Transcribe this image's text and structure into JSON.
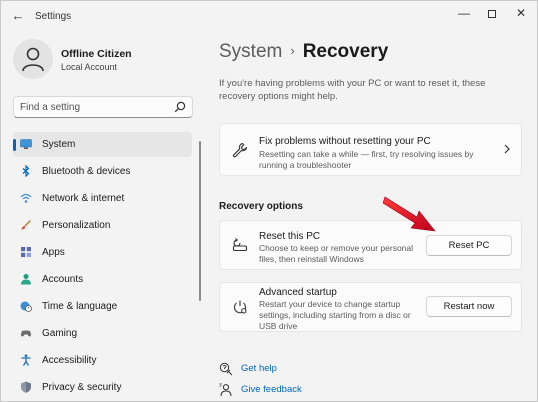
{
  "window": {
    "title": "Settings",
    "back": "←",
    "minimize": "—",
    "close": "✕"
  },
  "profile": {
    "name": "Offline Citizen",
    "account_type": "Local Account",
    "avatar_icon": "person-icon"
  },
  "search": {
    "placeholder": "Find a setting",
    "icon": "search-icon"
  },
  "nav": {
    "items": [
      {
        "label": "System",
        "icon": "monitor-icon",
        "active": true
      },
      {
        "label": "Bluetooth & devices",
        "icon": "bluetooth-icon"
      },
      {
        "label": "Network & internet",
        "icon": "wifi-icon"
      },
      {
        "label": "Personalization",
        "icon": "brush-icon"
      },
      {
        "label": "Apps",
        "icon": "apps-icon"
      },
      {
        "label": "Accounts",
        "icon": "person-icon"
      },
      {
        "label": "Time & language",
        "icon": "globe-clock-icon"
      },
      {
        "label": "Gaming",
        "icon": "gamepad-icon"
      },
      {
        "label": "Accessibility",
        "icon": "accessibility-icon"
      },
      {
        "label": "Privacy & security",
        "icon": "shield-icon"
      }
    ]
  },
  "breadcrumb": {
    "parent": "System",
    "separator": "›",
    "current": "Recovery"
  },
  "intro": "If you're having problems with your PC or want to reset it, these recovery options might help.",
  "fix_card": {
    "title": "Fix problems without resetting your PC",
    "description": "Resetting can take a while — first, try resolving issues by running a troubleshooter",
    "icon": "wrench-icon"
  },
  "recovery_options": {
    "title": "Recovery options",
    "reset": {
      "title": "Reset this PC",
      "description": "Choose to keep or remove your personal files, then reinstall Windows",
      "button": "Reset PC",
      "icon": "reset-pc-icon"
    },
    "advanced": {
      "title": "Advanced startup",
      "description": "Restart your device to change startup settings, including starting from a disc or USB drive",
      "button": "Restart now",
      "icon": "advanced-startup-icon"
    }
  },
  "links": {
    "help": "Get help",
    "feedback": "Give feedback"
  },
  "colors": {
    "accent": "#0067c0",
    "arrow": "#e81123"
  }
}
